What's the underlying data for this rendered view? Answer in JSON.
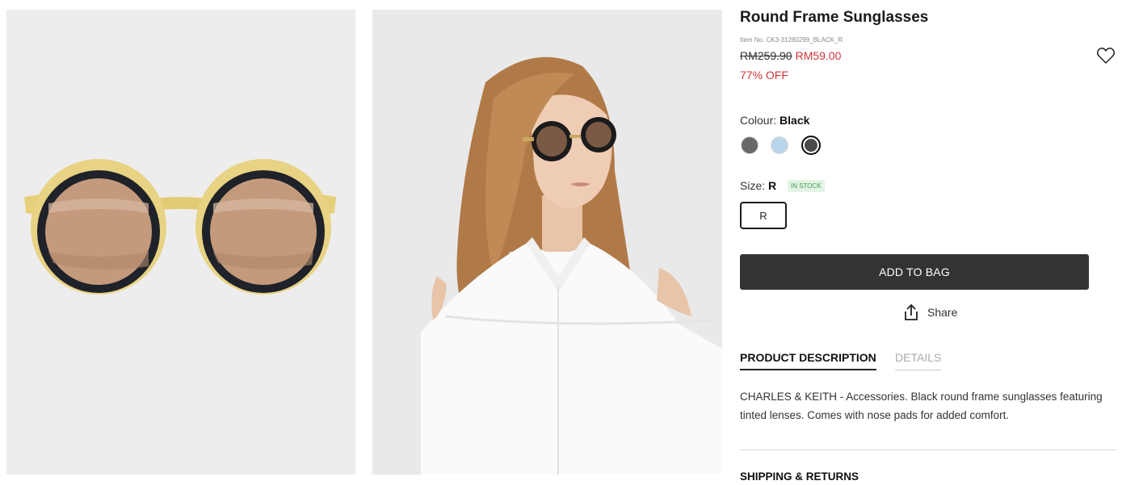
{
  "product": {
    "title": "Round Frame Sunglasses",
    "item_no": "Item No. CK3-31280299_BLACK_R",
    "old_price": "RM259.90",
    "new_price": "RM59.00",
    "discount": "77% OFF"
  },
  "colour": {
    "label": "Colour:",
    "selected": "Black",
    "swatches": [
      "#6a6868",
      "#b9d5ea",
      "#4a4a4a"
    ]
  },
  "size": {
    "label": "Size:",
    "selected": "R",
    "stock_status": "IN STOCK",
    "options": [
      "R"
    ]
  },
  "actions": {
    "add_to_bag": "ADD TO BAG",
    "share": "Share"
  },
  "tabs": {
    "description": "PRODUCT DESCRIPTION",
    "details": "DETAILS"
  },
  "description_text": "CHARLES & KEITH - Accessories. Black round frame sunglasses featuring tinted lenses. Comes with nose pads for added comfort.",
  "shipping_label": "SHIPPING & RETURNS",
  "icons": {
    "wishlist": "heart-icon",
    "share": "share-icon"
  },
  "colors": {
    "sale": "#d0343a",
    "button_bg": "#333333",
    "in_stock": "#3a9b4c"
  }
}
